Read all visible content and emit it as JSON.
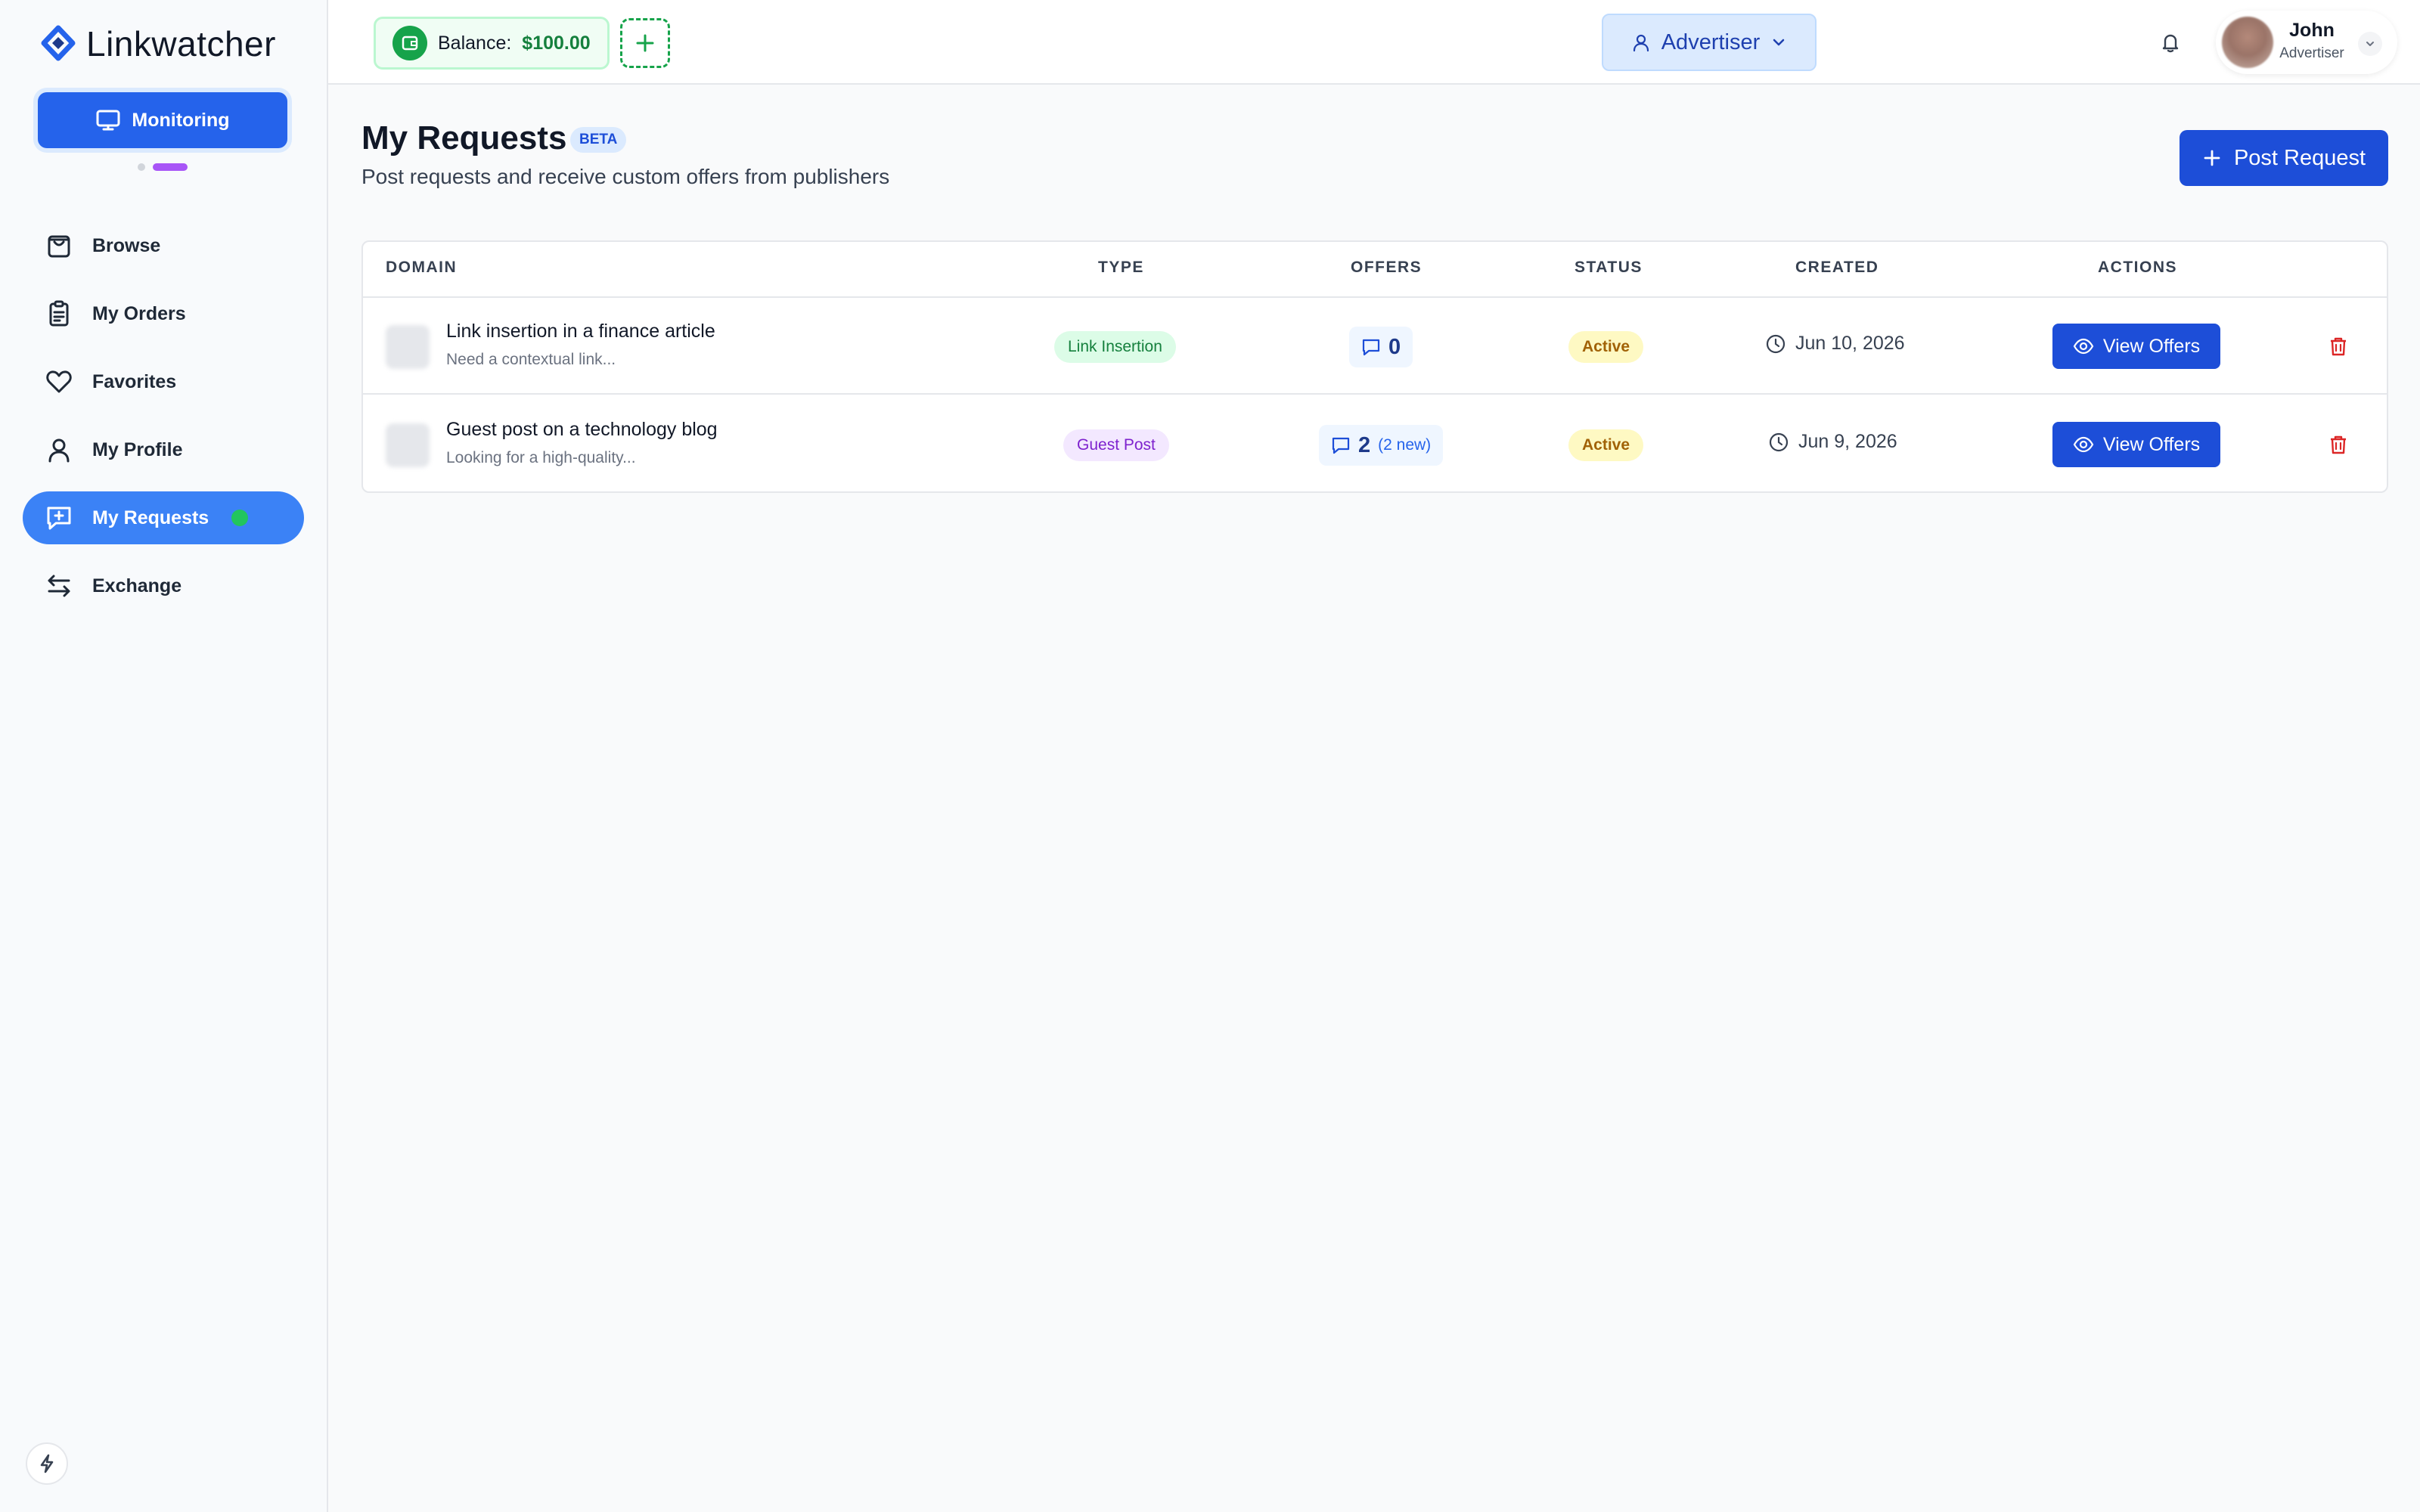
{
  "app": {
    "name": "Linkwatcher",
    "monitoring_label": "Monitoring"
  },
  "sidebar": {
    "items": [
      {
        "label": "Browse",
        "icon": "shopping-bag-icon"
      },
      {
        "label": "My Orders",
        "icon": "clipboard-icon"
      },
      {
        "label": "Favorites",
        "icon": "heart-icon"
      },
      {
        "label": "My Profile",
        "icon": "user-icon"
      },
      {
        "label": "My Requests",
        "icon": "message-plus-icon",
        "active": true
      },
      {
        "label": "Exchange",
        "icon": "arrows-exchange-icon"
      }
    ]
  },
  "topbar": {
    "balance_label": "Balance:",
    "balance_amount": "$100.00",
    "role": "Advertiser",
    "user_name": "John",
    "user_role": "Advertiser"
  },
  "page": {
    "title": "My Requests",
    "beta_badge": "BETA",
    "subtitle": "Post requests and receive custom offers from publishers",
    "post_button": "Post Request"
  },
  "table": {
    "headers": [
      "DOMAIN",
      "TYPE",
      "OFFERS",
      "STATUS",
      "CREATED",
      "ACTIONS"
    ],
    "rows": [
      {
        "title": "Link insertion in a finance article",
        "description": "Need a contextual link...",
        "type": "Link Insertion",
        "offers": "0",
        "offers_new": "",
        "status": "Active",
        "created": "Jun 10, 2026",
        "action": "View Offers"
      },
      {
        "title": "Guest post on a technology blog",
        "description": "Looking for a high-quality...",
        "type": "Guest Post",
        "offers": "2",
        "offers_new": "(2 new)",
        "status": "Active",
        "created": "Jun 9, 2026",
        "action": "View Offers"
      }
    ]
  },
  "colors": {
    "primary": "#1d4ed8",
    "active_nav": "#3b82f6",
    "success": "#16a34a",
    "danger": "#dc2626",
    "warning_bg": "#fef9c3"
  }
}
